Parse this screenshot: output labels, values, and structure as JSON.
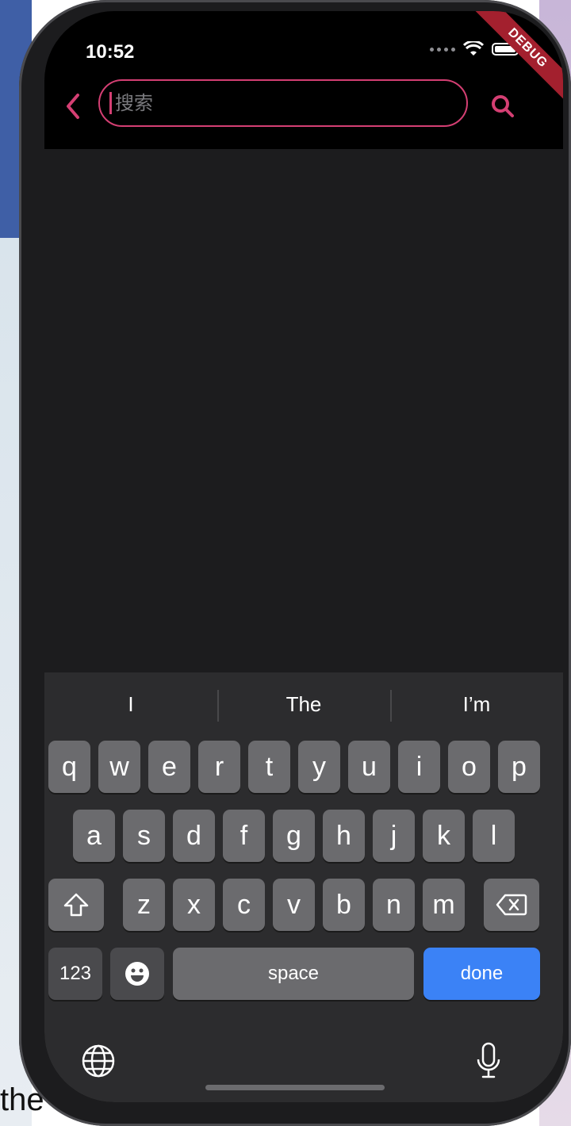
{
  "status_bar": {
    "time": "10:52"
  },
  "debug_banner": "DEBUG",
  "app_bar": {
    "search_placeholder": "搜索",
    "accent_color": "#d43f73"
  },
  "keyboard": {
    "suggestions": [
      "I",
      "The",
      "I’m"
    ],
    "row1": [
      "q",
      "w",
      "e",
      "r",
      "t",
      "y",
      "u",
      "i",
      "o",
      "p"
    ],
    "row2": [
      "a",
      "s",
      "d",
      "f",
      "g",
      "h",
      "j",
      "k",
      "l"
    ],
    "row3": [
      "z",
      "x",
      "c",
      "v",
      "b",
      "n",
      "m"
    ],
    "numbers_label": "123",
    "space_label": "space",
    "done_label": "done"
  },
  "background": {
    "peek_text": "the"
  }
}
